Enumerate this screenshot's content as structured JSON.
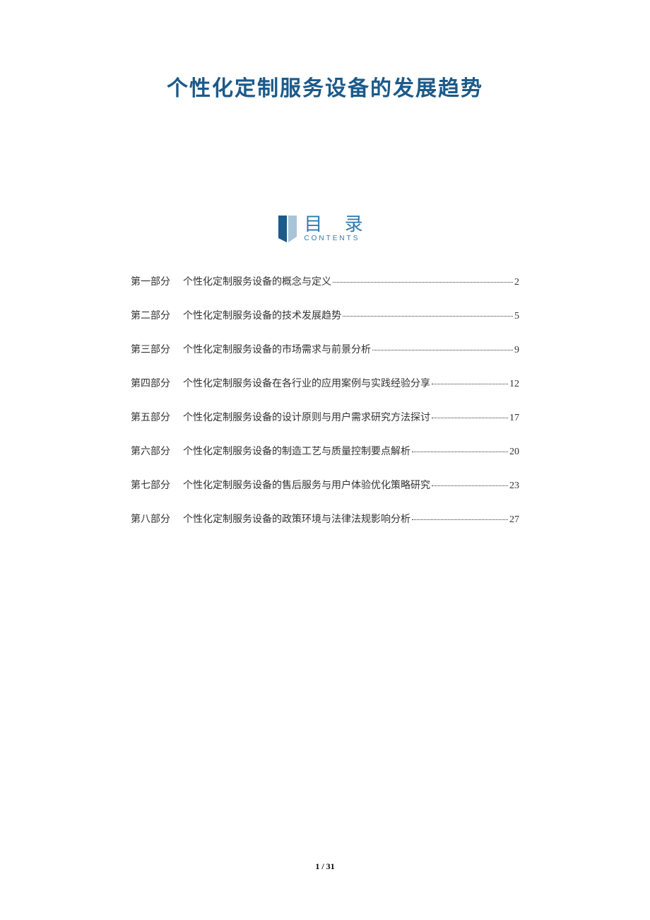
{
  "title": "个性化定制服务设备的发展趋势",
  "toc_header": {
    "cn": "目 录",
    "en": "CONTENTS"
  },
  "toc": [
    {
      "part": "第一部分",
      "text": "个性化定制服务设备的概念与定义",
      "page": "2"
    },
    {
      "part": "第二部分",
      "text": "个性化定制服务设备的技术发展趋势",
      "page": "5"
    },
    {
      "part": "第三部分",
      "text": "个性化定制服务设备的市场需求与前景分析",
      "page": "9"
    },
    {
      "part": "第四部分",
      "text": "个性化定制服务设备在各行业的应用案例与实践经验分享",
      "page": "12"
    },
    {
      "part": "第五部分",
      "text": "个性化定制服务设备的设计原则与用户需求研究方法探讨",
      "page": "17"
    },
    {
      "part": "第六部分",
      "text": "个性化定制服务设备的制造工艺与质量控制要点解析",
      "page": "20"
    },
    {
      "part": "第七部分",
      "text": "个性化定制服务设备的售后服务与用户体验优化策略研究",
      "page": "23"
    },
    {
      "part": "第八部分",
      "text": "个性化定制服务设备的政策环境与法律法规影响分析",
      "page": "27"
    }
  ],
  "footer": {
    "current": "1",
    "separator": " / ",
    "total": "31"
  }
}
